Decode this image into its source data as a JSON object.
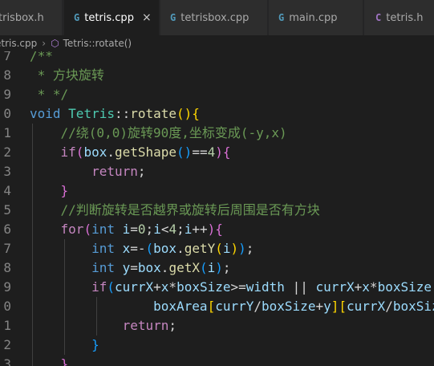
{
  "tabs": [
    {
      "label": "trisbox.h",
      "icon": "",
      "active": false
    },
    {
      "label": "tetris.cpp",
      "icon": "G",
      "active": true
    },
    {
      "label": "tetrisbox.cpp",
      "icon": "G",
      "active": false
    },
    {
      "label": "main.cpp",
      "icon": "G",
      "active": false
    },
    {
      "label": "tetris.h",
      "icon": "C",
      "active": false
    }
  ],
  "close_glyph": "×",
  "breadcrumb": {
    "file": "etris.cpp",
    "separator": "›",
    "symbol": "Tetris::rotate()"
  },
  "line_numbers": [
    "7",
    "8",
    "9",
    "0",
    "1",
    "2",
    "3",
    "4",
    "5",
    "6",
    "7",
    "8",
    "9",
    "0",
    "1",
    "2",
    "3"
  ],
  "code_lines": [
    [
      {
        "t": "/**",
        "c": "comment"
      }
    ],
    [
      {
        "t": " * 方块旋转",
        "c": "comment"
      }
    ],
    [
      {
        "t": " * */",
        "c": "comment"
      }
    ],
    [
      {
        "t": "void",
        "c": "kw"
      },
      {
        "t": " ",
        "c": "op"
      },
      {
        "t": "Tetris",
        "c": "type"
      },
      {
        "t": "::",
        "c": "op"
      },
      {
        "t": "rotate",
        "c": "fn"
      },
      {
        "t": "()",
        "c": "b1"
      },
      {
        "t": "{",
        "c": "b1"
      }
    ],
    [
      {
        "t": "    //绕(0,0)旋转90度,坐标变成(-y,x)",
        "c": "comment"
      }
    ],
    [
      {
        "t": "    ",
        "c": "op"
      },
      {
        "t": "if",
        "c": "ctrl"
      },
      {
        "t": "(",
        "c": "b2"
      },
      {
        "t": "box",
        "c": "var"
      },
      {
        "t": ".",
        "c": "op"
      },
      {
        "t": "getShape",
        "c": "fn"
      },
      {
        "t": "()",
        "c": "b3"
      },
      {
        "t": "==",
        "c": "op"
      },
      {
        "t": "4",
        "c": "num"
      },
      {
        "t": ")",
        "c": "b2"
      },
      {
        "t": "{",
        "c": "b2"
      }
    ],
    [
      {
        "t": "        ",
        "c": "op"
      },
      {
        "t": "return",
        "c": "ctrl"
      },
      {
        "t": ";",
        "c": "op"
      }
    ],
    [
      {
        "t": "    ",
        "c": "op"
      },
      {
        "t": "}",
        "c": "b2"
      }
    ],
    [
      {
        "t": "    //判断旋转是否越界或旋转后周围是否有方块",
        "c": "comment"
      }
    ],
    [
      {
        "t": "    ",
        "c": "op"
      },
      {
        "t": "for",
        "c": "ctrl"
      },
      {
        "t": "(",
        "c": "b2"
      },
      {
        "t": "int",
        "c": "kw"
      },
      {
        "t": " ",
        "c": "op"
      },
      {
        "t": "i",
        "c": "var"
      },
      {
        "t": "=",
        "c": "op"
      },
      {
        "t": "0",
        "c": "num"
      },
      {
        "t": ";",
        "c": "op"
      },
      {
        "t": "i",
        "c": "var"
      },
      {
        "t": "<",
        "c": "op"
      },
      {
        "t": "4",
        "c": "num"
      },
      {
        "t": ";",
        "c": "op"
      },
      {
        "t": "i",
        "c": "var"
      },
      {
        "t": "++",
        "c": "op"
      },
      {
        "t": ")",
        "c": "b2"
      },
      {
        "t": "{",
        "c": "b2"
      }
    ],
    [
      {
        "t": "        ",
        "c": "op"
      },
      {
        "t": "int",
        "c": "kw"
      },
      {
        "t": " ",
        "c": "op"
      },
      {
        "t": "x",
        "c": "var"
      },
      {
        "t": "=-",
        "c": "op"
      },
      {
        "t": "(",
        "c": "b3"
      },
      {
        "t": "box",
        "c": "var"
      },
      {
        "t": ".",
        "c": "op"
      },
      {
        "t": "getY",
        "c": "fn"
      },
      {
        "t": "(",
        "c": "b1"
      },
      {
        "t": "i",
        "c": "var"
      },
      {
        "t": ")",
        "c": "b1"
      },
      {
        "t": ")",
        "c": "b3"
      },
      {
        "t": ";",
        "c": "op"
      }
    ],
    [
      {
        "t": "        ",
        "c": "op"
      },
      {
        "t": "int",
        "c": "kw"
      },
      {
        "t": " ",
        "c": "op"
      },
      {
        "t": "y",
        "c": "var"
      },
      {
        "t": "=",
        "c": "op"
      },
      {
        "t": "box",
        "c": "var"
      },
      {
        "t": ".",
        "c": "op"
      },
      {
        "t": "getX",
        "c": "fn"
      },
      {
        "t": "(",
        "c": "b3"
      },
      {
        "t": "i",
        "c": "var"
      },
      {
        "t": ")",
        "c": "b3"
      },
      {
        "t": ";",
        "c": "op"
      }
    ],
    [
      {
        "t": "        ",
        "c": "op"
      },
      {
        "t": "if",
        "c": "ctrl"
      },
      {
        "t": "(",
        "c": "b3"
      },
      {
        "t": "currX",
        "c": "var"
      },
      {
        "t": "+",
        "c": "op"
      },
      {
        "t": "x",
        "c": "var"
      },
      {
        "t": "*",
        "c": "op"
      },
      {
        "t": "boxSize",
        "c": "var"
      },
      {
        "t": ">=",
        "c": "op"
      },
      {
        "t": "width",
        "c": "var"
      },
      {
        "t": " || ",
        "c": "op"
      },
      {
        "t": "currX",
        "c": "var"
      },
      {
        "t": "+",
        "c": "op"
      },
      {
        "t": "x",
        "c": "var"
      },
      {
        "t": "*",
        "c": "op"
      },
      {
        "t": "boxSize",
        "c": "var"
      }
    ],
    [
      {
        "t": "                ",
        "c": "op"
      },
      {
        "t": "boxArea",
        "c": "var"
      },
      {
        "t": "[",
        "c": "b1"
      },
      {
        "t": "currY",
        "c": "var"
      },
      {
        "t": "/",
        "c": "op"
      },
      {
        "t": "boxSize",
        "c": "var"
      },
      {
        "t": "+",
        "c": "op"
      },
      {
        "t": "y",
        "c": "var"
      },
      {
        "t": "]",
        "c": "b1"
      },
      {
        "t": "[",
        "c": "b1"
      },
      {
        "t": "currX",
        "c": "var"
      },
      {
        "t": "/",
        "c": "op"
      },
      {
        "t": "boxSize",
        "c": "var"
      }
    ],
    [
      {
        "t": "            ",
        "c": "op"
      },
      {
        "t": "return",
        "c": "ctrl"
      },
      {
        "t": ";",
        "c": "op"
      }
    ],
    [
      {
        "t": "        ",
        "c": "op"
      },
      {
        "t": "}",
        "c": "b3"
      }
    ],
    [
      {
        "t": "    ",
        "c": "op"
      },
      {
        "t": "}",
        "c": "b2"
      }
    ]
  ],
  "colors": {
    "background": "#1e1e1e",
    "tab_inactive": "#2d2d2d",
    "comment": "#6a9955",
    "keyword": "#569cd6",
    "control": "#c586c0",
    "type": "#4ec9b0",
    "function": "#dcdcaa",
    "variable": "#9cdcfe",
    "number": "#b5cea8"
  }
}
